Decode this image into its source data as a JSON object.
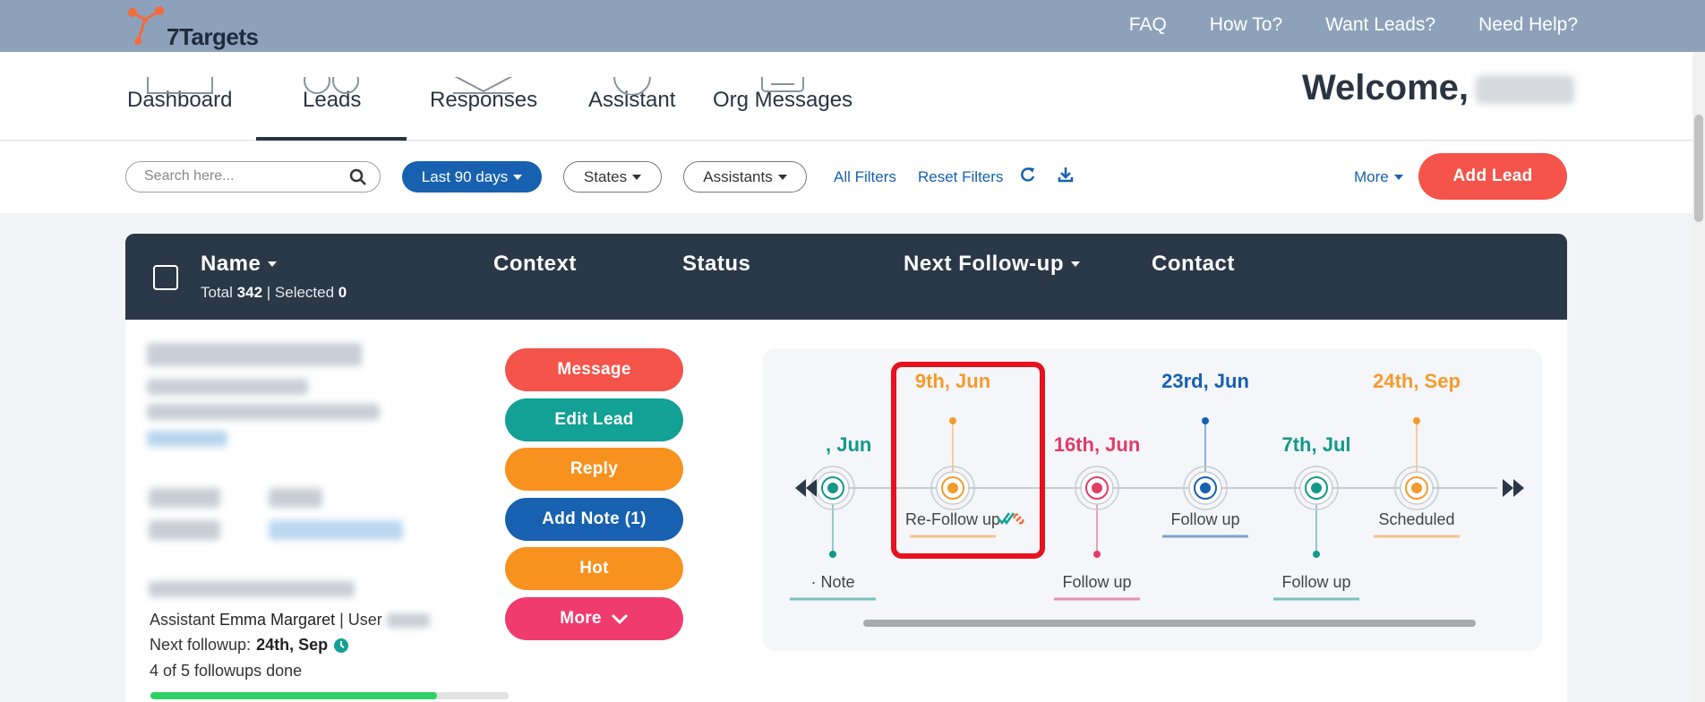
{
  "brand": {
    "name": "7Targets"
  },
  "topnav": {
    "faq": "FAQ",
    "how_to": "How To?",
    "want_leads": "Want Leads?",
    "need_help": "Need Help?"
  },
  "tabs": {
    "dashboard": "Dashboard",
    "leads": "Leads",
    "responses": "Responses",
    "assistant": "Assistant",
    "org_messages": "Org Messages"
  },
  "welcome": {
    "greeting": "Welcome,"
  },
  "filters": {
    "search_placeholder": "Search here...",
    "date_range": "Last 90 days",
    "states": "States",
    "assistants": "Assistants",
    "all_filters": "All Filters",
    "reset_filters": "Reset Filters",
    "more": "More",
    "add_lead": "Add Lead"
  },
  "table": {
    "col_name": "Name",
    "col_context": "Context",
    "col_status": "Status",
    "col_next_followup": "Next Follow-up",
    "col_contact": "Contact",
    "total_label": "Total",
    "total_value": "342",
    "selected_label": "| Selected",
    "selected_value": "0"
  },
  "lead": {
    "assistant_label": "Assistant",
    "assistant_name": "Emma Margaret",
    "user_label": "| User",
    "next_followup_label": "Next followup:",
    "next_followup_value": "24th, Sep",
    "followups_done": "4 of 5 followups done",
    "followups_completed": 4,
    "followups_total": 5
  },
  "actions": {
    "message": "Message",
    "edit_lead": "Edit Lead",
    "reply": "Reply",
    "add_note": "Add Note (1)",
    "hot": "Hot",
    "more": "More"
  },
  "timeline": {
    "events": [
      {
        "date": ", Jun",
        "label": "· Note",
        "color": "#13988b"
      },
      {
        "date": "9th, Jun",
        "label": "Re-Follow up",
        "color": "#f49b2e"
      },
      {
        "date": "16th, Jun",
        "label": "Follow up",
        "color": "#e23c69"
      },
      {
        "date": "23rd, Jun",
        "label": "Follow up",
        "color": "#1761b0"
      },
      {
        "date": "7th, Jul",
        "label": "Follow up",
        "color": "#13988b"
      },
      {
        "date": "24th, Sep",
        "label": "Scheduled",
        "color": "#f49b2e"
      }
    ]
  },
  "colors": {
    "topbar": "#8da2ba",
    "primary": "#1761b0",
    "add_lead": "#f5544a",
    "table_header": "#2a3847",
    "message": "#f5544a",
    "edit_lead": "#13a095",
    "reply": "#f7921e",
    "add_note": "#1761b0",
    "hot": "#f7921e",
    "more": "#ef3b6e",
    "highlight": "#e8101e"
  },
  "icons": {
    "search": "search-icon",
    "refresh": "refresh-icon",
    "download": "download-icon",
    "clock": "clock-icon",
    "chevron": "chevron-down-icon",
    "rewind": "rewind-icon",
    "forward": "fast-forward-icon",
    "check": "double-check-icon",
    "link": "link-icon"
  }
}
